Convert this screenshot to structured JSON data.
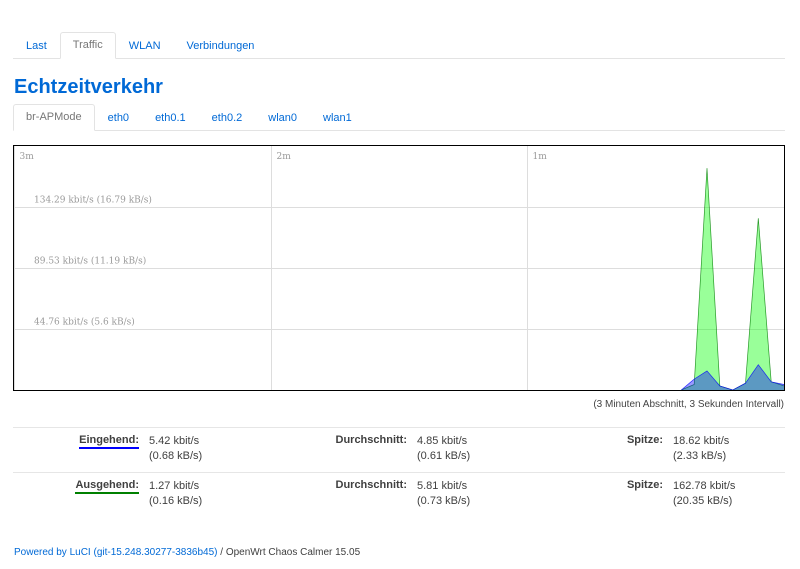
{
  "top_tabs": [
    {
      "label": "Last",
      "active": false
    },
    {
      "label": "Traffic",
      "active": true
    },
    {
      "label": "WLAN",
      "active": false
    },
    {
      "label": "Verbindungen",
      "active": false
    }
  ],
  "page_title": "Echtzeitverkehr",
  "interface_tabs": [
    {
      "label": "br-APMode",
      "active": true
    },
    {
      "label": "eth0",
      "active": false
    },
    {
      "label": "eth0.1",
      "active": false
    },
    {
      "label": "eth0.2",
      "active": false
    },
    {
      "label": "wlan0",
      "active": false
    },
    {
      "label": "wlan1",
      "active": false
    }
  ],
  "graph": {
    "time_labels": [
      "3m",
      "2m",
      "1m"
    ],
    "level_labels": [
      "134.29 kbit/s (16.79 kB/s)",
      "89.53 kbit/s (11.19 kB/s)",
      "44.76 kbit/s (5.6 kB/s)"
    ],
    "colors": {
      "rx_stroke": "#0000ff",
      "rx_fill": "#0000ff",
      "tx_stroke": "#008000",
      "tx_fill": "#00ff00",
      "grid": "#dddddd",
      "label": "#999999"
    }
  },
  "chart_data": {
    "type": "area",
    "x_unit": "seconds ago",
    "xlim": [
      180,
      0
    ],
    "ylim": [
      0,
      179.05
    ],
    "series": [
      {
        "name": "Eingehend",
        "x": [
          24,
          21,
          18,
          15,
          12,
          9,
          6,
          3,
          0
        ],
        "values": [
          0,
          8,
          14,
          3,
          0,
          5,
          18.6,
          6,
          4
        ]
      },
      {
        "name": "Ausgehend",
        "x": [
          24,
          21,
          18,
          15,
          12,
          9,
          6,
          3,
          0
        ],
        "values": [
          0,
          4,
          162.8,
          3,
          0,
          5,
          126,
          6,
          3
        ]
      }
    ]
  },
  "interval_note": "(3 Minuten Abschnitt, 3 Sekunden Intervall)",
  "stats": {
    "rx": {
      "label": "Eingehend:",
      "current": "5.42 kbit/s",
      "current_kb": "(0.68 kB/s)",
      "avg_label": "Durchschnitt:",
      "avg": "4.85 kbit/s",
      "avg_kb": "(0.61 kB/s)",
      "peak_label": "Spitze:",
      "peak": "18.62 kbit/s",
      "peak_kb": "(2.33 kB/s)"
    },
    "tx": {
      "label": "Ausgehend:",
      "current": "1.27 kbit/s",
      "current_kb": "(0.16 kB/s)",
      "avg_label": "Durchschnitt:",
      "avg": "5.81 kbit/s",
      "avg_kb": "(0.73 kB/s)",
      "peak_label": "Spitze:",
      "peak": "162.78 kbit/s",
      "peak_kb": "(20.35 kB/s)"
    }
  },
  "footer": {
    "link_text": "Powered by LuCI (git-15.248.30277-3836b45)",
    "rest_text": " / OpenWrt Chaos Calmer 15.05"
  }
}
